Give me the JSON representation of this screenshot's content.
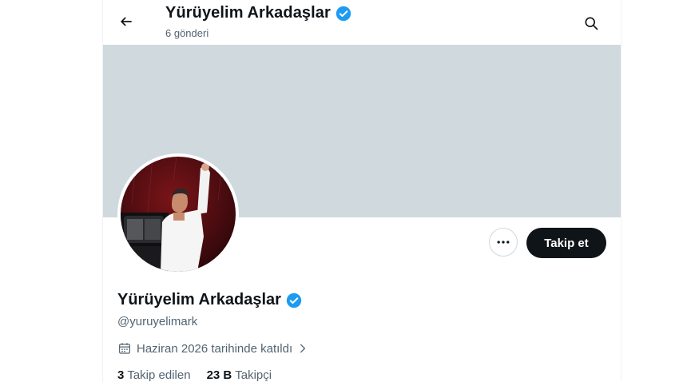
{
  "header": {
    "title": "Yürüyelim Arkadaşlar",
    "post_count": "6 gönderi",
    "back_icon": "arrow-left-icon",
    "search_icon": "search-icon"
  },
  "profile": {
    "display_name": "Yürüyelim Arkadaşlar",
    "handle": "@yuruyelimark",
    "joined": "Haziran 2026 tarihinde katıldı",
    "verified": true,
    "follow_label": "Takip et"
  },
  "stats": {
    "following_count": "3",
    "following_label": "Takip edilen",
    "followers_count": "23 B",
    "followers_label": "Takipçi"
  },
  "colors": {
    "verified_blue": "#1d9bf0",
    "banner": "#cfd9de",
    "button_dark": "#0f1419",
    "secondary_text": "#536471"
  }
}
